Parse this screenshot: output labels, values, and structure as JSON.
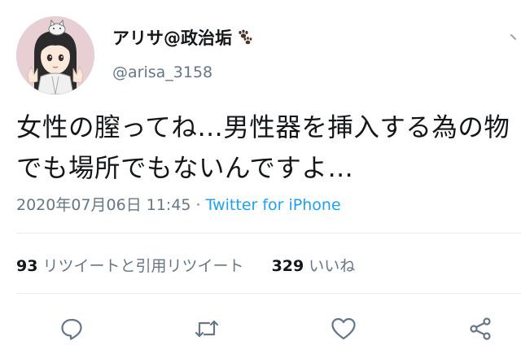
{
  "author": {
    "display_name": "アリサ@政治垢",
    "handle": "@arisa_3158",
    "avatar_icon": "avatar-anime-girl",
    "name_emoji_icon": "paw-prints-icon"
  },
  "tweet": {
    "text_lines": [
      "女性の膣ってね…男性器を挿入する為の物",
      "でも場所でもないんですよ…"
    ],
    "timestamp": "2020年07月06日 11:45",
    "separator": " · ",
    "source": "Twitter for iPhone"
  },
  "stats": {
    "retweet_count": "93",
    "retweet_label": "リツイートと引用リツイート",
    "like_count": "329",
    "like_label": "いいね"
  },
  "actions": {
    "reply_icon": "reply-icon",
    "retweet_icon": "retweet-icon",
    "like_icon": "heart-icon",
    "share_icon": "share-icon"
  },
  "colors": {
    "text": "#14171a",
    "secondary": "#657786",
    "link": "#1da1f2",
    "divider": "#e6ecf0"
  }
}
